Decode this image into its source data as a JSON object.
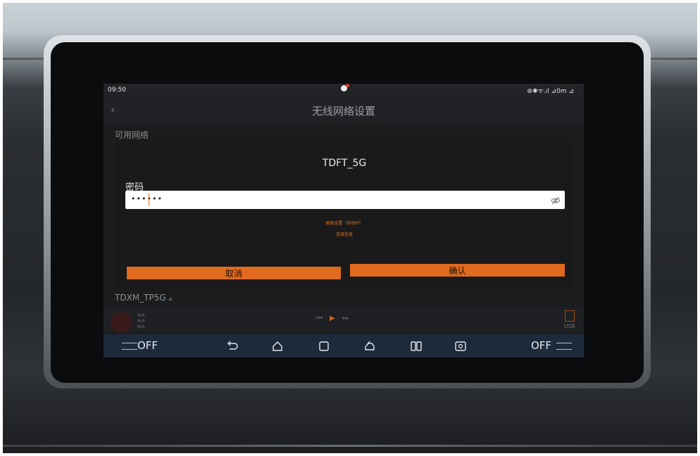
{
  "status_bar": {
    "time": "09:50",
    "indicators": "⊛✱ᯤ.ıl ⊿0m ⊿"
  },
  "header": {
    "back_icon": "chevron-left-icon",
    "title": "无线网络设置"
  },
  "wifi": {
    "section_title": "可用网络",
    "networks": [
      {
        "ssid": "TDXM_TP5G"
      }
    ]
  },
  "dialog": {
    "ssid": "TDFT_5G",
    "password_label": "密码",
    "password_value": "••••••",
    "show_password_icon": "eye-slash-icon",
    "advanced_label": "高级设置（自动IP）",
    "advanced_sub": "连接信息",
    "cancel_label": "取消",
    "confirm_label": "确认"
  },
  "media": {
    "lines": [
      "N/A",
      "N/A",
      "N/A"
    ],
    "source": "USB"
  },
  "navbar": {
    "left_fan": "OFF",
    "right_fan": "OFF"
  },
  "colors": {
    "accent": "#e06a1e",
    "dialog_bg": "#1a1a1a",
    "navbar_bg": "#1d2a3b"
  }
}
